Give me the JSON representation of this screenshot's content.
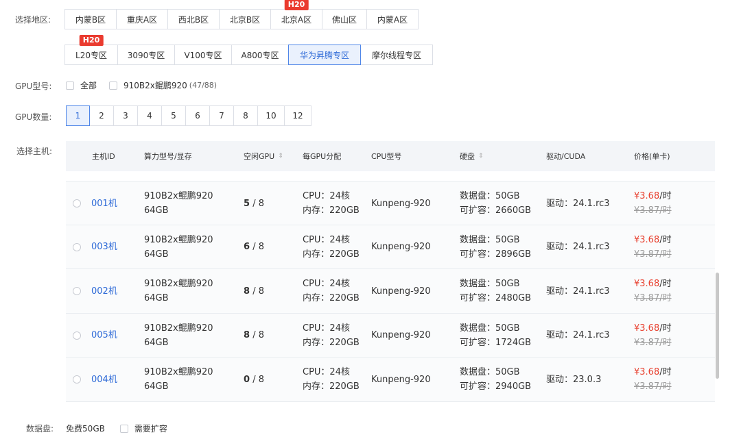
{
  "region": {
    "label": "选择地区:",
    "row1": [
      "内蒙B区",
      "重庆A区",
      "西北B区",
      "北京B区",
      "北京A区",
      "佛山区",
      "内蒙A区"
    ],
    "row1_badge": "H20",
    "row2": [
      "L20专区",
      "3090专区",
      "V100专区",
      "A800专区",
      "华为昇腾专区",
      "摩尔线程专区"
    ],
    "row2_badge": "H20",
    "selected": "华为昇腾专区"
  },
  "gpu_model": {
    "label": "GPU型号:",
    "option_all": "全部",
    "option_1": "910B2x鲲鹏920",
    "option_1_count": "(47/88)"
  },
  "gpu_count": {
    "label": "GPU数量:",
    "options": [
      "1",
      "2",
      "3",
      "4",
      "5",
      "6",
      "7",
      "8",
      "10",
      "12"
    ],
    "selected": "1"
  },
  "host": {
    "label": "选择主机:",
    "columns": {
      "id": "主机ID",
      "model": "算力型号/显存",
      "free_gpu": "空闲GPU",
      "per_gpu": "每GPU分配",
      "cpu_model": "CPU型号",
      "disk": "硬盘",
      "driver": "驱动/CUDA",
      "price": "价格(单卡)"
    },
    "rows": [
      {
        "id": "001机",
        "model": "910B2x鲲鹏920",
        "mem": "64GB",
        "free": "5",
        "total": "/ 8",
        "cpu": "CPU：24核",
        "ram": "内存：220GB",
        "cpu_model": "Kunpeng-920",
        "disk": "数据盘：50GB",
        "expand": "可扩容：2660GB",
        "driver": "驱动：24.1.rc3",
        "price": "¥3.68",
        "unit": "/时",
        "old_price": "¥3.87/时"
      },
      {
        "id": "003机",
        "model": "910B2x鲲鹏920",
        "mem": "64GB",
        "free": "6",
        "total": "/ 8",
        "cpu": "CPU：24核",
        "ram": "内存：220GB",
        "cpu_model": "Kunpeng-920",
        "disk": "数据盘：50GB",
        "expand": "可扩容：2896GB",
        "driver": "驱动：24.1.rc3",
        "price": "¥3.68",
        "unit": "/时",
        "old_price": "¥3.87/时"
      },
      {
        "id": "002机",
        "model": "910B2x鲲鹏920",
        "mem": "64GB",
        "free": "8",
        "total": "/ 8",
        "cpu": "CPU：24核",
        "ram": "内存：220GB",
        "cpu_model": "Kunpeng-920",
        "disk": "数据盘：50GB",
        "expand": "可扩容：2480GB",
        "driver": "驱动：24.1.rc3",
        "price": "¥3.68",
        "unit": "/时",
        "old_price": "¥3.87/时"
      },
      {
        "id": "005机",
        "model": "910B2x鲲鹏920",
        "mem": "64GB",
        "free": "8",
        "total": "/ 8",
        "cpu": "CPU：24核",
        "ram": "内存：220GB",
        "cpu_model": "Kunpeng-920",
        "disk": "数据盘：50GB",
        "expand": "可扩容：1724GB",
        "driver": "驱动：24.1.rc3",
        "price": "¥3.68",
        "unit": "/时",
        "old_price": "¥3.87/时"
      },
      {
        "id": "004机",
        "model": "910B2x鲲鹏920",
        "mem": "64GB",
        "free": "0",
        "total": "/ 8",
        "cpu": "CPU：24核",
        "ram": "内存：220GB",
        "cpu_model": "Kunpeng-920",
        "disk": "数据盘：50GB",
        "expand": "可扩容：2940GB",
        "driver": "驱动：23.0.3",
        "price": "¥3.68",
        "unit": "/时",
        "old_price": "¥3.87/时"
      }
    ]
  },
  "data_disk": {
    "label": "数据盘:",
    "value": "免费50GB",
    "expand_option": "需要扩容"
  },
  "colors": {
    "accent": "#2e6ad7",
    "price": "#e8402f",
    "badge": "#ea3b2f"
  }
}
